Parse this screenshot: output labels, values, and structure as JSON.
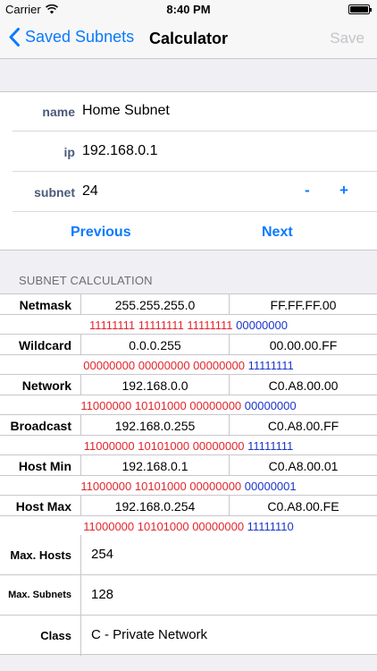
{
  "status_bar": {
    "carrier": "Carrier",
    "time": "8:40 PM"
  },
  "nav": {
    "back_label": "Saved Subnets",
    "title": "Calculator",
    "save_label": "Save"
  },
  "form": {
    "name_label": "name",
    "name_value": "Home Subnet",
    "ip_label": "ip",
    "ip_value": "192.168.0.1",
    "subnet_label": "subnet",
    "subnet_value": "24",
    "minus_label": "-",
    "plus_label": "+",
    "previous_label": "Previous",
    "next_label": "Next"
  },
  "section_header": "SUBNET CALCULATION",
  "calc": {
    "netmask": {
      "label": "Netmask",
      "dec": "255.255.255.0",
      "hex": "FF.FF.FF.00",
      "bin_net": "11111111 11111111 11111111",
      "bin_host": "00000000"
    },
    "wildcard": {
      "label": "Wildcard",
      "dec": "0.0.0.255",
      "hex": "00.00.00.FF",
      "bin_net": "00000000 00000000 00000000",
      "bin_host": "11111111"
    },
    "network": {
      "label": "Network",
      "dec": "192.168.0.0",
      "hex": "C0.A8.00.00",
      "bin_net": "11000000 10101000 00000000",
      "bin_host": "00000000"
    },
    "broadcast": {
      "label": "Broadcast",
      "dec": "192.168.0.255",
      "hex": "C0.A8.00.FF",
      "bin_net": "11000000 10101000 00000000",
      "bin_host": "11111111"
    },
    "host_min": {
      "label": "Host Min",
      "dec": "192.168.0.1",
      "hex": "C0.A8.00.01",
      "bin_net": "11000000 10101000 00000000",
      "bin_host": "00000001"
    },
    "host_max": {
      "label": "Host Max",
      "dec": "192.168.0.254",
      "hex": "C0.A8.00.FE",
      "bin_net": "11000000 10101000 00000000",
      "bin_host": "11111110"
    }
  },
  "info": {
    "max_hosts_label": "Max. Hosts",
    "max_hosts_value": "254",
    "max_subnets_label": "Max. Subnets",
    "max_subnets_value": "128",
    "class_label": "Class",
    "class_value": "C - Private Network"
  },
  "colors": {
    "accent": "#0a7aff",
    "network_bits": "#e2252b",
    "host_bits": "#1a35c8"
  },
  "icons": [
    "wifi-icon",
    "battery-icon",
    "chevron-left-icon"
  ]
}
